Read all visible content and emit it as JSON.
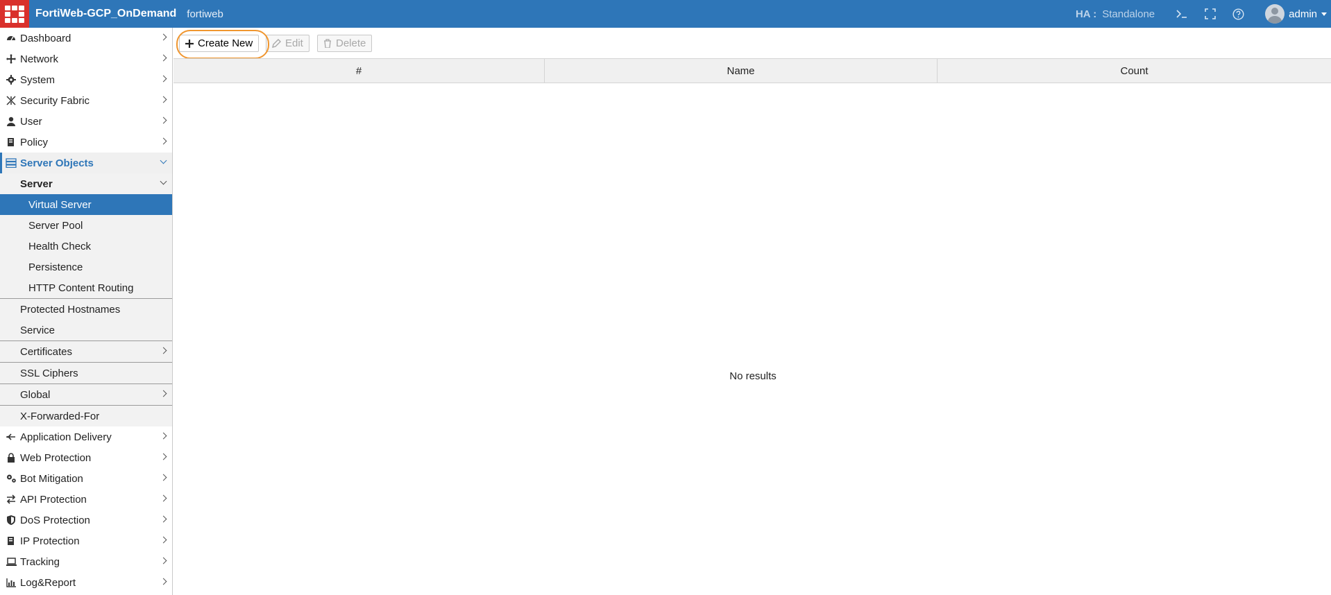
{
  "header": {
    "app_title": "FortiWeb-GCP_OnDemand",
    "hostname": "fortiweb",
    "ha_label": "HA :",
    "ha_value": "Standalone",
    "user": "admin",
    "colors": {
      "bar": "#2e76b8",
      "logo": "#d9302c"
    }
  },
  "sidebar": {
    "items": [
      {
        "label": "Dashboard",
        "icon": "dashboard-icon"
      },
      {
        "label": "Network",
        "icon": "network-icon"
      },
      {
        "label": "System",
        "icon": "gear-icon"
      },
      {
        "label": "Security Fabric",
        "icon": "security-fabric-icon"
      },
      {
        "label": "User",
        "icon": "user-icon"
      },
      {
        "label": "Policy",
        "icon": "policy-icon"
      },
      {
        "label": "Server Objects",
        "icon": "server-objects-icon"
      }
    ],
    "server_objects_children": {
      "server_group": "Server",
      "server_children": [
        "Virtual Server",
        "Server Pool",
        "Health Check",
        "Persistence",
        "HTTP Content Routing"
      ],
      "protected_hostnames": "Protected Hostnames",
      "service": "Service",
      "certificates": "Certificates",
      "ssl_ciphers": "SSL Ciphers",
      "global": "Global",
      "x_forwarded_for": "X-Forwarded-For"
    },
    "items_after": [
      {
        "label": "Application Delivery",
        "icon": "application-delivery-icon"
      },
      {
        "label": "Web Protection",
        "icon": "lock-icon"
      },
      {
        "label": "Bot Mitigation",
        "icon": "bot-mitigation-icon"
      },
      {
        "label": "API Protection",
        "icon": "api-protection-icon"
      },
      {
        "label": "DoS Protection",
        "icon": "shield-icon"
      },
      {
        "label": "IP Protection",
        "icon": "ip-protection-icon"
      },
      {
        "label": "Tracking",
        "icon": "laptop-icon"
      },
      {
        "label": "Log&Report",
        "icon": "bar-chart-icon"
      }
    ]
  },
  "toolbar": {
    "create_label": "Create New",
    "edit_label": "Edit",
    "delete_label": "Delete",
    "highlight_color": "#f0962f"
  },
  "table": {
    "columns": [
      "#",
      "Name",
      "Count"
    ],
    "empty_text": "No results"
  }
}
